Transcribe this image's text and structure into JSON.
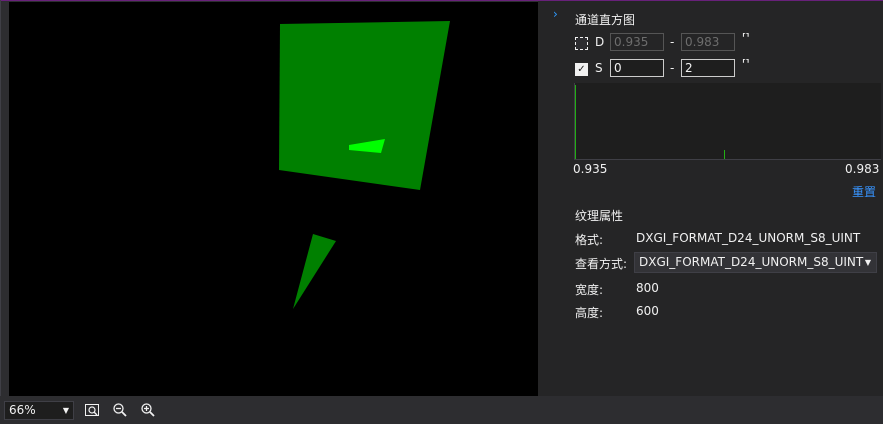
{
  "histogram": {
    "title": "通道直方图",
    "depth": {
      "label": "D",
      "checked": false,
      "min": "0.935",
      "max": "0.983"
    },
    "stencil": {
      "label": "S",
      "checked": true,
      "min": "0",
      "max": "2"
    },
    "range_separator": "-",
    "axis_min": "0.935",
    "axis_max": "0.983",
    "reset_label": "重置"
  },
  "properties": {
    "title": "纹理属性",
    "format_label": "格式:",
    "format_value": "DXGI_FORMAT_D24_UNORM_S8_UINT",
    "view_label": "查看方式:",
    "view_value": "DXGI_FORMAT_D24_UNORM_S8_UINT",
    "width_label": "宽度:",
    "width_value": "800",
    "height_label": "高度:",
    "height_value": "600"
  },
  "statusbar": {
    "zoom": "66%"
  },
  "colors": {
    "stencil_green": "#008000",
    "highlight_green": "#00ff00",
    "accent_blue": "#3794ff"
  }
}
